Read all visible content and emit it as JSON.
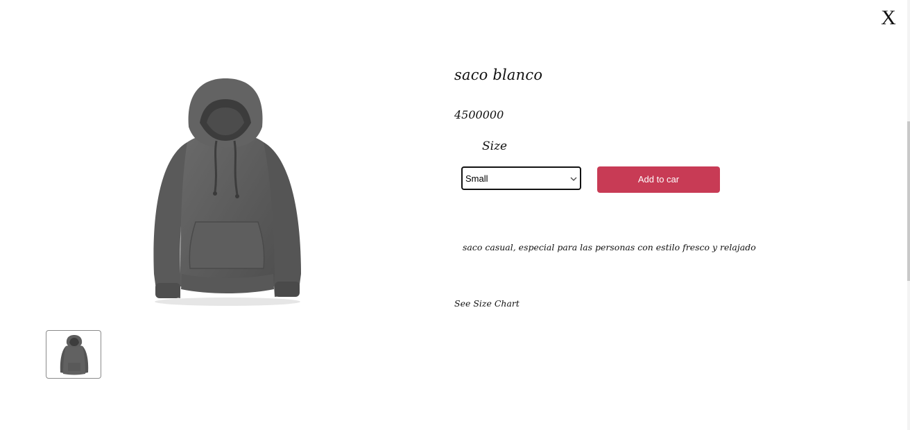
{
  "modal": {
    "close_label": "X"
  },
  "product": {
    "title": "saco blanco",
    "price": "4500000",
    "size_label": "Size",
    "size_selected": "Small",
    "add_button_label": "Add to car",
    "description": "saco casual, especial para las personas con estilo fresco y relajado",
    "size_chart_link": "See Size Chart",
    "image_icon": "gray-hoodie-image",
    "accent_color": "#c83b55"
  }
}
